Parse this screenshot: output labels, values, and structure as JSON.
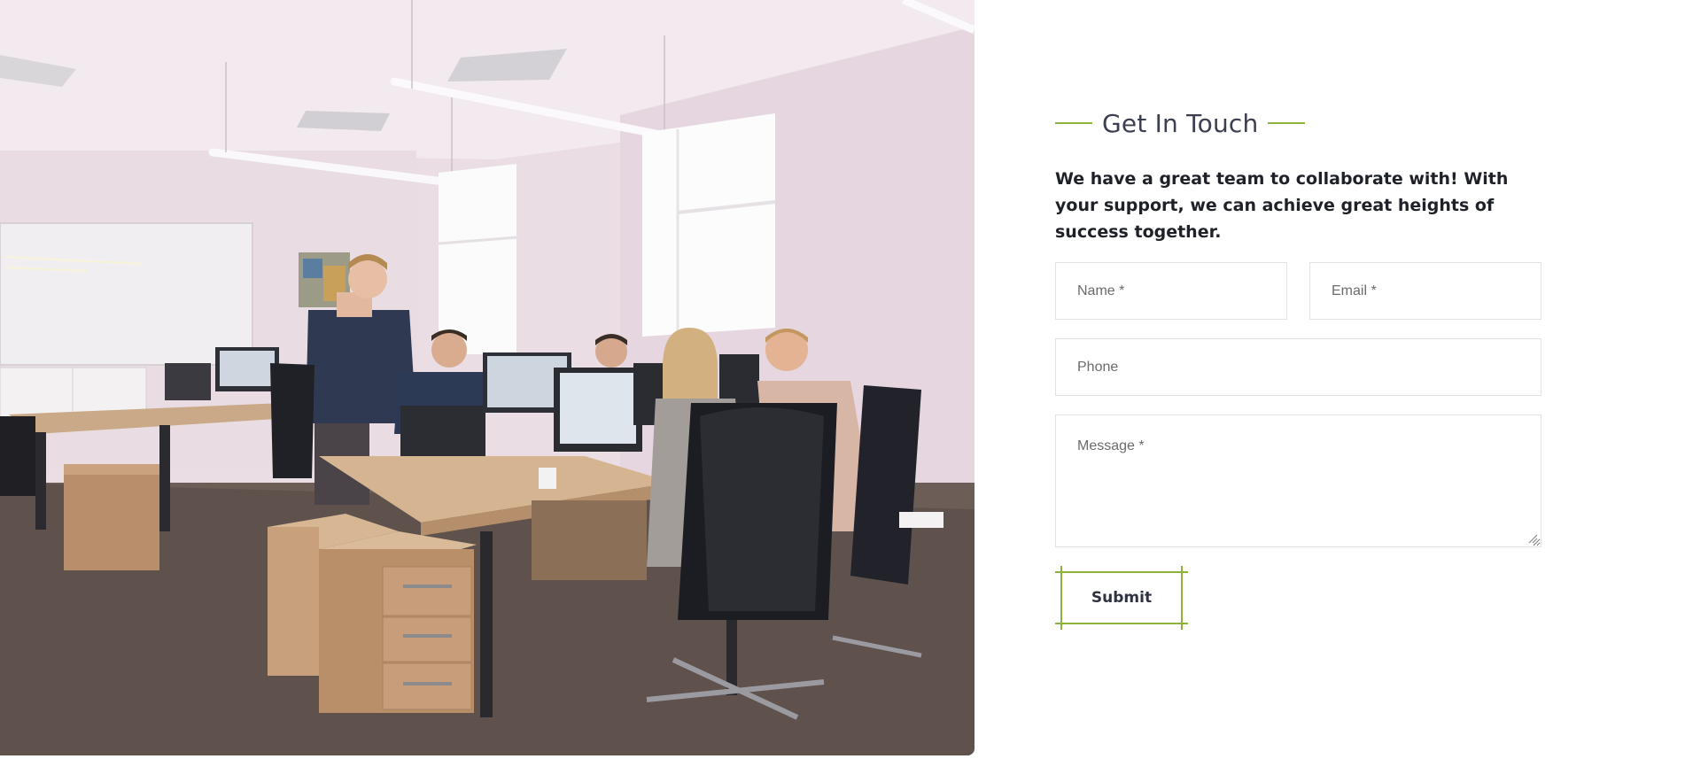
{
  "photo": {
    "alt_subject": "office-team-photo"
  },
  "contact": {
    "heading": "Get In Touch",
    "intro": "We have a great team to collaborate with! With your support, we can achieve great heights of success together.",
    "fields": {
      "name_placeholder": "Name *",
      "email_placeholder": "Email *",
      "phone_placeholder": "Phone",
      "message_placeholder": "Message *"
    },
    "submit_label": "Submit"
  },
  "colors": {
    "accent": "#8cb43a",
    "heading": "#3b3f4f",
    "body_text": "#1f2128",
    "field_border": "#e2e2e2"
  }
}
